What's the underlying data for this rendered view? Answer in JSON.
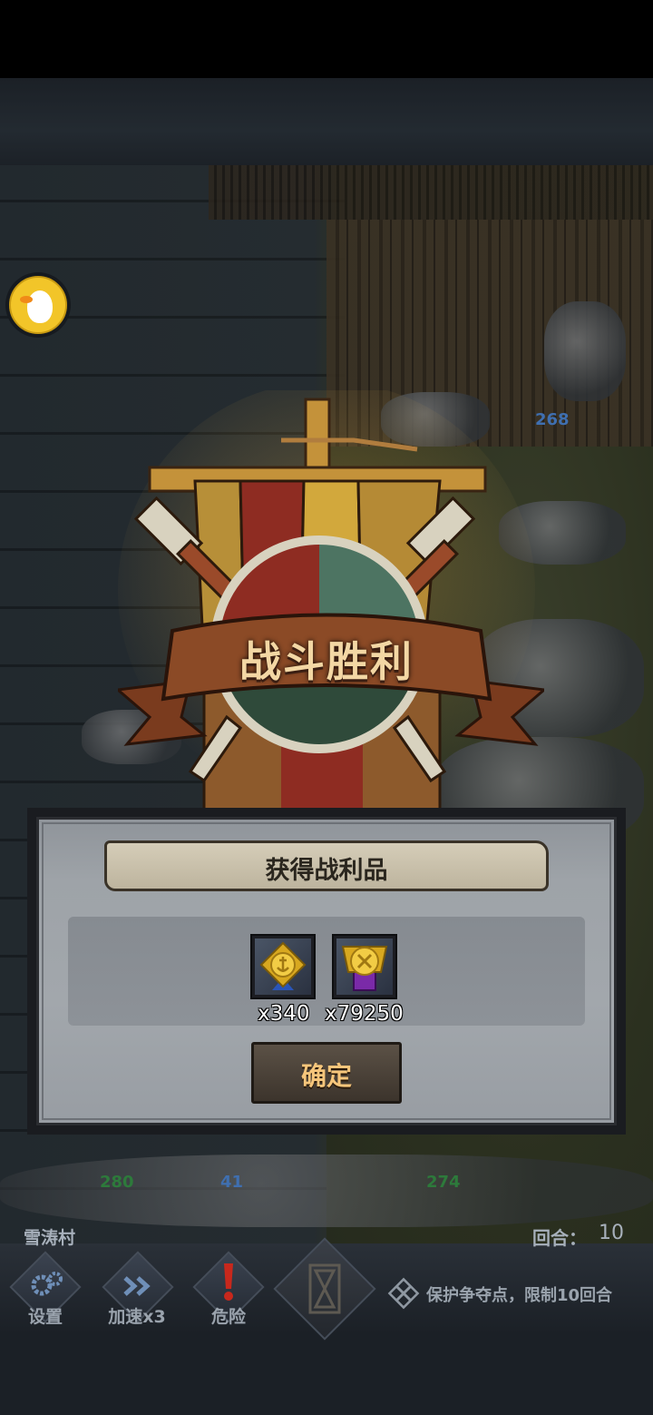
{
  "battle": {
    "result_title": "战斗胜利",
    "unit_counts": [
      "268",
      "280",
      "41",
      "274"
    ]
  },
  "loot": {
    "title": "获得战利品",
    "items": [
      {
        "icon": "gold-anchor-medal-icon",
        "count": "x340",
        "ribbon_color": "#2a55b8"
      },
      {
        "icon": "gold-cross-medal-icon",
        "count": "x79250",
        "ribbon_color": "#7a2aa8"
      }
    ],
    "confirm_label": "确定"
  },
  "status": {
    "location": "雪涛村",
    "round_label": "回合：",
    "round_value": "10"
  },
  "toolbar": {
    "settings_label": "设置",
    "speed_label": "加速x3",
    "danger_label": "危险",
    "objective": "保护争夺点，限制10回合"
  },
  "colors": {
    "victory_text": "#f3d7a4",
    "confirm_text": "#f6c67b"
  }
}
